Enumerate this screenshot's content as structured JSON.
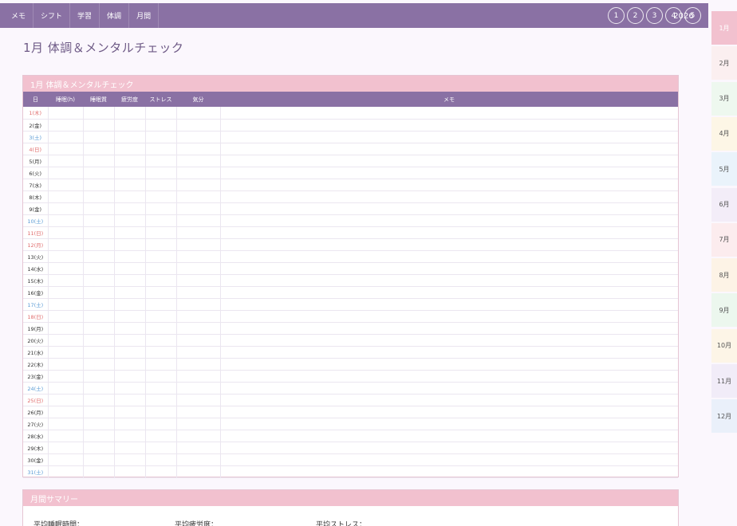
{
  "nav": {
    "items": [
      "メモ",
      "シフト",
      "学習",
      "体調",
      "月間"
    ],
    "number_buttons": [
      "1",
      "2",
      "3",
      "4",
      "5"
    ],
    "year": "2026"
  },
  "page_title": "1月 体調＆メンタルチェック",
  "table": {
    "title": "1月 体調＆メンタルチェック",
    "columns": [
      "日",
      "睡眠(h)",
      "睡眠質",
      "疲労度",
      "ストレス",
      "気分",
      "メモ"
    ],
    "days": [
      {
        "label": "1(木)",
        "type": "sun"
      },
      {
        "label": "2(金)",
        "type": "weekday"
      },
      {
        "label": "3(土)",
        "type": "sat"
      },
      {
        "label": "4(日)",
        "type": "sun"
      },
      {
        "label": "5(月)",
        "type": "weekday"
      },
      {
        "label": "6(火)",
        "type": "weekday"
      },
      {
        "label": "7(水)",
        "type": "weekday"
      },
      {
        "label": "8(木)",
        "type": "weekday"
      },
      {
        "label": "9(金)",
        "type": "weekday"
      },
      {
        "label": "10(土)",
        "type": "sat"
      },
      {
        "label": "11(日)",
        "type": "sun"
      },
      {
        "label": "12(月)",
        "type": "sun"
      },
      {
        "label": "13(火)",
        "type": "weekday"
      },
      {
        "label": "14(水)",
        "type": "weekday"
      },
      {
        "label": "15(木)",
        "type": "weekday"
      },
      {
        "label": "16(金)",
        "type": "weekday"
      },
      {
        "label": "17(土)",
        "type": "sat"
      },
      {
        "label": "18(日)",
        "type": "sun"
      },
      {
        "label": "19(月)",
        "type": "weekday"
      },
      {
        "label": "20(火)",
        "type": "weekday"
      },
      {
        "label": "21(水)",
        "type": "weekday"
      },
      {
        "label": "22(木)",
        "type": "weekday"
      },
      {
        "label": "23(金)",
        "type": "weekday"
      },
      {
        "label": "24(土)",
        "type": "sat"
      },
      {
        "label": "25(日)",
        "type": "sun"
      },
      {
        "label": "26(月)",
        "type": "weekday"
      },
      {
        "label": "27(火)",
        "type": "weekday"
      },
      {
        "label": "28(水)",
        "type": "weekday"
      },
      {
        "label": "29(木)",
        "type": "weekday"
      },
      {
        "label": "30(金)",
        "type": "weekday"
      },
      {
        "label": "31(土)",
        "type": "sat"
      }
    ]
  },
  "summary": {
    "title": "月間サマリー",
    "items": [
      "平均睡眠時間：",
      "平均疲労度：",
      "平均ストレス："
    ]
  },
  "months": [
    {
      "label": "1月",
      "color": "#f2c1cf",
      "active": true
    },
    {
      "label": "2月",
      "color": "#fbeff0",
      "active": false
    },
    {
      "label": "3月",
      "color": "#eef8ef",
      "active": false
    },
    {
      "label": "4月",
      "color": "#fdf6e6",
      "active": false
    },
    {
      "label": "5月",
      "color": "#eaf3fb",
      "active": false
    },
    {
      "label": "6月",
      "color": "#f3edf8",
      "active": false
    },
    {
      "label": "7月",
      "color": "#fcecee",
      "active": false
    },
    {
      "label": "8月",
      "color": "#fdf3e6",
      "active": false
    },
    {
      "label": "9月",
      "color": "#ecf7ee",
      "active": false
    },
    {
      "label": "10月",
      "color": "#fdf5e7",
      "active": false
    },
    {
      "label": "11月",
      "color": "#f1ecf8",
      "active": false
    },
    {
      "label": "12月",
      "color": "#eaf0fa",
      "active": false
    }
  ]
}
